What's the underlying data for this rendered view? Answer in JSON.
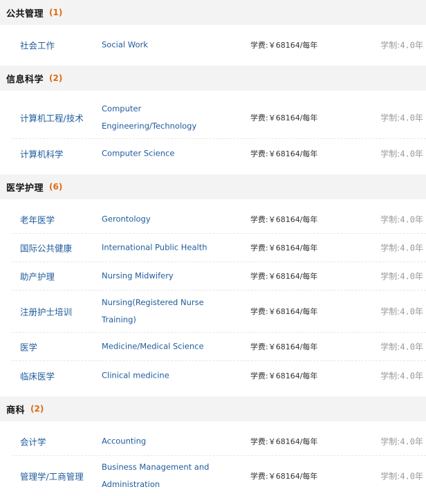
{
  "sections": [
    {
      "title": "公共管理",
      "count": "(1)",
      "programs": [
        {
          "cn": "社会工作",
          "en": "Social Work",
          "fee_label": "学费:",
          "fee_value": "￥68164/每年",
          "dur_label": "学制:",
          "dur_value": "4.0年"
        }
      ]
    },
    {
      "title": "信息科学",
      "count": "(2)",
      "programs": [
        {
          "cn": "计算机工程/技术",
          "en": "Computer Engineering/Technology",
          "fee_label": "学费:",
          "fee_value": "￥68164/每年",
          "dur_label": "学制:",
          "dur_value": "4.0年"
        },
        {
          "cn": "计算机科学",
          "en": "Computer Science",
          "fee_label": "学费:",
          "fee_value": "￥68164/每年",
          "dur_label": "学制:",
          "dur_value": "4.0年"
        }
      ]
    },
    {
      "title": "医学护理",
      "count": "(6)",
      "programs": [
        {
          "cn": "老年医学",
          "en": "Gerontology",
          "fee_label": "学费:",
          "fee_value": "￥68164/每年",
          "dur_label": "学制:",
          "dur_value": "4.0年"
        },
        {
          "cn": "国际公共健康",
          "en": "International Public Health",
          "fee_label": "学费:",
          "fee_value": "￥68164/每年",
          "dur_label": "学制:",
          "dur_value": "4.0年"
        },
        {
          "cn": "助产护理",
          "en": "Nursing Midwifery",
          "fee_label": "学费:",
          "fee_value": "￥68164/每年",
          "dur_label": "学制:",
          "dur_value": "4.0年"
        },
        {
          "cn": "注册护士培训",
          "en": "Nursing(Registered Nurse Training)",
          "fee_label": "学费:",
          "fee_value": "￥68164/每年",
          "dur_label": "学制:",
          "dur_value": "4.0年"
        },
        {
          "cn": "医学",
          "en": "Medicine/Medical Science",
          "fee_label": "学费:",
          "fee_value": "￥68164/每年",
          "dur_label": "学制:",
          "dur_value": "4.0年"
        },
        {
          "cn": "临床医学",
          "en": "Clinical medicine",
          "fee_label": "学费:",
          "fee_value": "￥68164/每年",
          "dur_label": "学制:",
          "dur_value": "4.0年"
        }
      ]
    },
    {
      "title": "商科",
      "count": "(2)",
      "programs": [
        {
          "cn": "会计学",
          "en": "Accounting",
          "fee_label": "学费:",
          "fee_value": "￥68164/每年",
          "dur_label": "学制:",
          "dur_value": "4.0年"
        },
        {
          "cn": "管理学/工商管理",
          "en": "Business Management and Administration",
          "fee_label": "学费:",
          "fee_value": "￥68164/每年",
          "dur_label": "学制:",
          "dur_value": "4.0年"
        }
      ]
    }
  ]
}
